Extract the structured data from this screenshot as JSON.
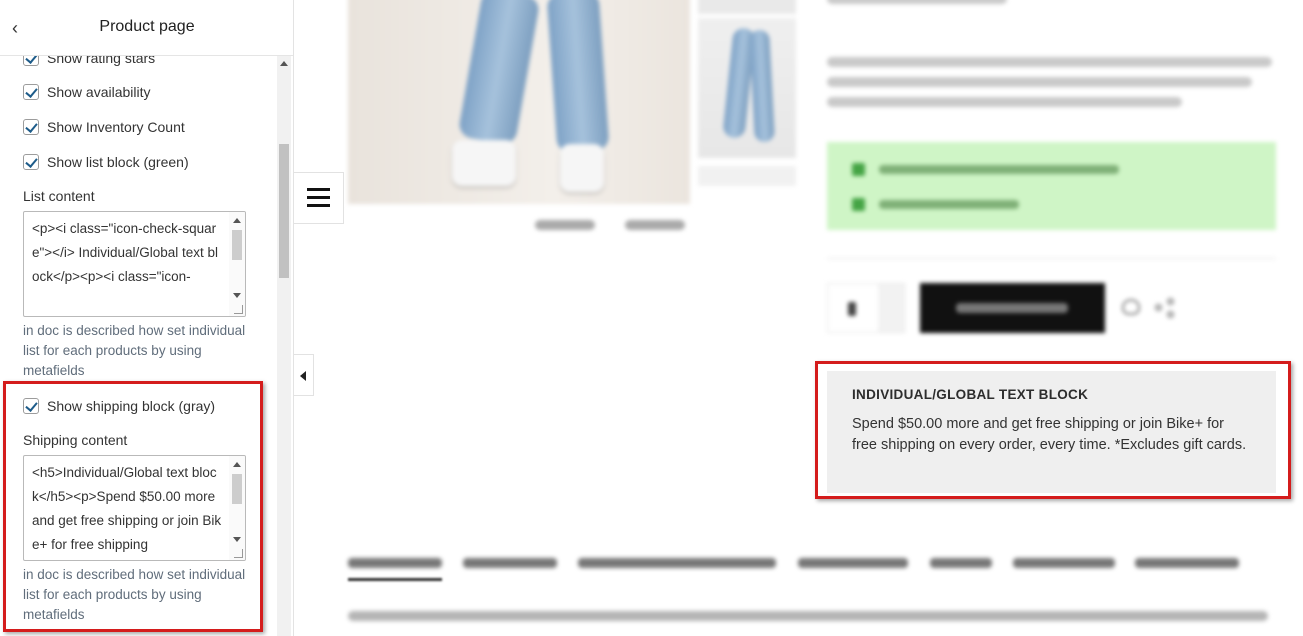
{
  "sidebar": {
    "title": "Product page",
    "items": [
      {
        "label": "Show rating stars",
        "checked": true
      },
      {
        "label": "Show availability",
        "checked": true
      },
      {
        "label": "Show Inventory Count",
        "checked": true
      },
      {
        "label": "Show list block (green)",
        "checked": true
      }
    ],
    "list_content": {
      "label": "List content",
      "value": "<p><i class=\"icon-check-square\"></i> Individual/Global text block</p><p><i class=\"icon-",
      "hint": "in doc is described how set individual list for each products by using metafields"
    },
    "shipping": {
      "checkbox_label": "Show shipping block (gray)",
      "checked": true,
      "label": "Shipping content",
      "value": "<h5>Individual/Global text block</h5><p>Spend $50.00 more and get free shipping or join Bike+ for free shipping",
      "hint": "in doc is described how set individual list for each products by using metafields"
    }
  },
  "preview": {
    "text_block": {
      "heading": "INDIVIDUAL/GLOBAL TEXT BLOCK",
      "body": "Spend $50.00 more and get free shipping or join Bike+ for free shipping on every order, every time. *Excludes gift cards."
    }
  },
  "colors": {
    "highlight": "#d41c1c",
    "green_block": "#cff5c6",
    "gray_block": "#efefef"
  }
}
